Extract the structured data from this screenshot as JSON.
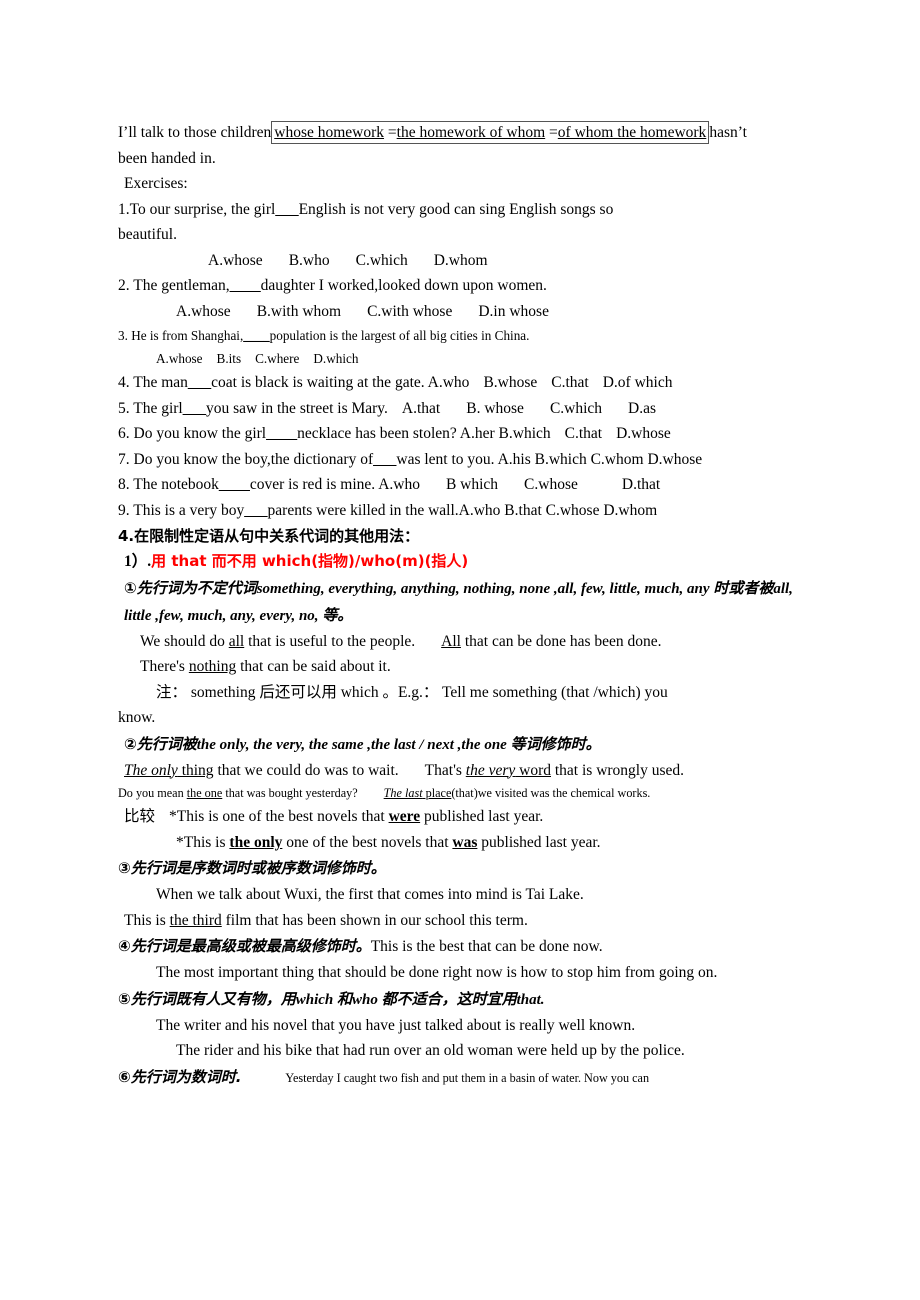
{
  "document": {
    "intro": {
      "before": "I’ll talk to those children",
      "boxed_parts": [
        "whose homework",
        " =",
        "the homework of whom",
        " =",
        "of whom the homework"
      ],
      "boxed_full": "whose homework =the homework of whom =of whom the homework",
      "after": "hasn’t",
      "line2": "been handed in."
    },
    "exercises_label": "Exercises:",
    "exercises": [
      {
        "number": "1.",
        "stem_a": "To our surprise, the girl",
        "blank": "___",
        "stem_b": "English is not very good can sing English songs so",
        "stem_wrap": "beautiful.",
        "options": [
          "A.whose",
          "B.who",
          "C.which",
          "D.whom"
        ],
        "options_inline": false,
        "size": "normal"
      },
      {
        "number": "2.",
        "stem_a": " The gentleman,",
        "blank": "____",
        "stem_b": "daughter I worked,looked down upon women.",
        "options": [
          "A.whose",
          "B.with whom",
          "C.with whose",
          "D.in whose"
        ],
        "options_inline": false,
        "size": "normal"
      },
      {
        "number": "3.",
        "stem_a": " He is from Shanghai,",
        "blank": "____",
        "stem_b": "population is the largest of all big cities in China.",
        "options": [
          "A.whose",
          "B.its",
          "C.where",
          "D.which"
        ],
        "options_inline": false,
        "size": "small"
      },
      {
        "number": "4.",
        "stem_a": " The man",
        "blank": "___",
        "stem_b": "coat is black is waiting at the gate.",
        "options": [
          "A.who",
          "B.whose",
          "C.that",
          "D.of which"
        ],
        "options_inline": true,
        "size": "normal"
      },
      {
        "number": "5.",
        "stem_a": " The girl",
        "blank": "___",
        "stem_b": "you saw in the street is Mary.",
        "options": [
          "A.that",
          "B. whose",
          "C.which",
          "D.as"
        ],
        "options_inline": true,
        "size": "normal"
      },
      {
        "number": "6.",
        "stem_a": " Do you know the girl",
        "blank": "____",
        "stem_b": "necklace has been stolen?",
        "options": [
          "A.her",
          "B.which",
          "C.that",
          "D.whose"
        ],
        "options_inline": true,
        "size": "normal"
      },
      {
        "number": "7.",
        "stem_a": " Do you know the boy,the dictionary of",
        "blank": "___",
        "stem_b": "was lent to you.",
        "options": [
          "A.his",
          "B.which",
          "C.whom",
          "D.whose"
        ],
        "options_inline": true,
        "size": "normal"
      },
      {
        "number": "8.",
        "stem_a": " The notebook",
        "blank": "____",
        "stem_b": "cover is red is mine.",
        "options": [
          "A.who",
          "B which",
          "C.whose",
          "D.that"
        ],
        "options_inline": true,
        "size": "normal"
      },
      {
        "number": "9.",
        "stem_a": " This is a very boy",
        "blank": "___",
        "stem_b": "parents were killed in the wall.",
        "options": [
          "A.who",
          "B.that",
          "C.whose",
          "D.whom"
        ],
        "options_inline": true,
        "size": "normal"
      }
    ],
    "section4": {
      "heading": "4.在限制性定语从句中关系代词的其他用法：",
      "item1_prefix": "1）.",
      "item1_red": "用 that 而不用 which(指物)/who(m)(指人)",
      "red_color": "#ff0000",
      "rules": [
        {
          "marker": "①",
          "zh1": "先行词为不定代词",
          "en1": "something, everything, anything, nothing, none ,all, few, little, much, any",
          "zh2": "时或者被",
          "en2": "all, little ,few, much, any, every, no,",
          "zh3": "等。",
          "examples": [
            {
              "parts": [
                {
                  "t": "We should do ",
                  "style": "plain"
                },
                {
                  "t": "all",
                  "style": "underline"
                },
                {
                  "t": " that is useful to the people.",
                  "style": "plain"
                }
              ],
              "second": [
                {
                  "t": "All",
                  "style": "underline"
                },
                {
                  "t": " that can be done has been done.",
                  "style": "plain"
                }
              ]
            },
            {
              "parts": [
                {
                  "t": "There's ",
                  "style": "plain"
                },
                {
                  "t": "nothing",
                  "style": "underline"
                },
                {
                  "t": " that can be said about it.",
                  "style": "plain"
                }
              ]
            }
          ],
          "note": "注： something 后还可以用 which 。E.g.： Tell me something (that /which) you",
          "note_wrap": "know."
        },
        {
          "marker": "②",
          "zh1": "先行词被",
          "en1": "the only, the very, the same ,the last / next ,the one",
          "zh2": "等词修饰时。",
          "ex_a1": "The only",
          "ex_a2": " thing",
          "ex_a3": " that we could do was to wait.",
          "ex_b1": "That's ",
          "ex_b2": "the very",
          "ex_b3": " word",
          "ex_b4": " that is wrongly used.",
          "small_a1": "Do you mean ",
          "small_a2": "the one",
          "small_a3": " that was bought yesterday?",
          "small_b1": "The last",
          "small_b2": " place",
          "small_b3": "(that)we visited was the chemical works.",
          "compare_label": "比较",
          "compare1_a": "*This is one of the best novels that ",
          "compare1_b": "were",
          "compare1_c": " published last year.",
          "compare2_a": "*This is ",
          "compare2_b": "the only",
          "compare2_c": " one of the best novels that ",
          "compare2_d": "was",
          "compare2_e": " published last year."
        },
        {
          "marker": "③",
          "zh1": "先行词是序数词时或被序数词修饰时。",
          "ex1": "When we talk about Wuxi, the first that comes into mind is Tai Lake.",
          "ex2_a": "This is ",
          "ex2_b": "the third",
          "ex2_c": " film that has been shown in our school this term."
        },
        {
          "marker": "④",
          "zh1": "先行词是最高级或被最高级修饰时。",
          "tail": "This is the best that can be done now.",
          "ex1": "The most important thing that should be done right now is how to stop him from going on."
        },
        {
          "marker": "⑤",
          "zh1": "先行词既有人又有物，用",
          "en1": "which",
          "zh2": "和",
          "en2": "who",
          "zh3": "都不适合，这时宜用",
          "en3": "that.",
          "ex1": "The writer and his novel that you have just talked about is really well known.",
          "ex2": "The rider and his bike that had run over an old woman were held up by the police."
        },
        {
          "marker": "⑥",
          "zh1": "先行词为数词时.",
          "tail": "Yesterday I caught two fish and put them in a basin of water. Now you can"
        }
      ]
    }
  }
}
